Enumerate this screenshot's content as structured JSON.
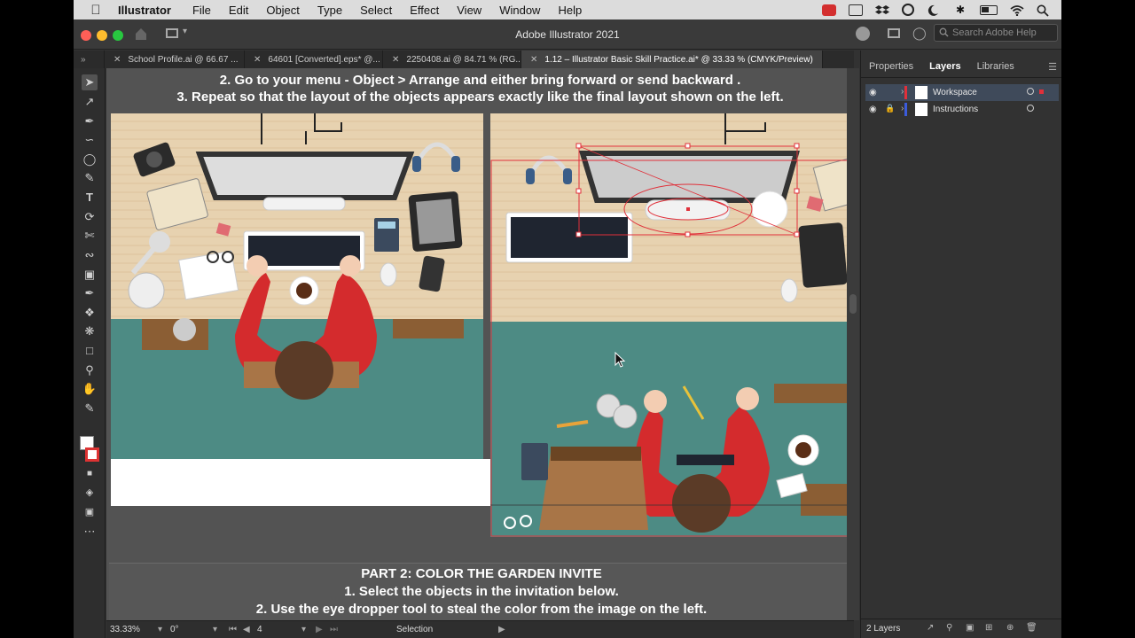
{
  "menubar": {
    "app_name": "Illustrator",
    "items": [
      "File",
      "Edit",
      "Object",
      "Type",
      "Select",
      "Effect",
      "View",
      "Window",
      "Help"
    ]
  },
  "window": {
    "title": "Adobe Illustrator 2021",
    "search_placeholder": "Search Adobe Help"
  },
  "tabs": [
    {
      "label": "School Profile.ai @ 66.67 ..."
    },
    {
      "label": "64601 [Converted].eps* @..."
    },
    {
      "label": "2250408.ai @ 84.71 % (RG..."
    },
    {
      "label": "1.12 – Illustrator Basic Skill Practice.ai* @ 33.33 % (CMYK/Preview)"
    }
  ],
  "canvas": {
    "instruction_line2": "2. Go to your menu  - Object > Arrange and either bring forward or send backward .",
    "instruction_line3": "3. Repeat so that the layout of the objects  appears exactly like the final layout shown on the left.",
    "part2_title": "PART 2: COLOR THE GARDEN INVITE",
    "part2_line1": "1. Select the objects in the invitation below.",
    "part2_line2": "2. Use the eye dropper tool to steal the color from the image on the left."
  },
  "statusbar": {
    "zoom": "33.33%",
    "rotation": "0°",
    "artboard": "4",
    "tool": "Selection"
  },
  "panel": {
    "tabs": [
      "Properties",
      "Layers",
      "Libraries"
    ],
    "layers": [
      {
        "name": "Workspace",
        "color": "#e0303a"
      },
      {
        "name": "Instructions",
        "color": "#3b5bdb"
      }
    ],
    "layer_count": "2 Layers"
  },
  "colors": {
    "desk_wood": "#e7d2b0",
    "floor_teal": "#4d8b84",
    "shirt_red": "#d42b2d",
    "selection_red": "#e0303a"
  }
}
